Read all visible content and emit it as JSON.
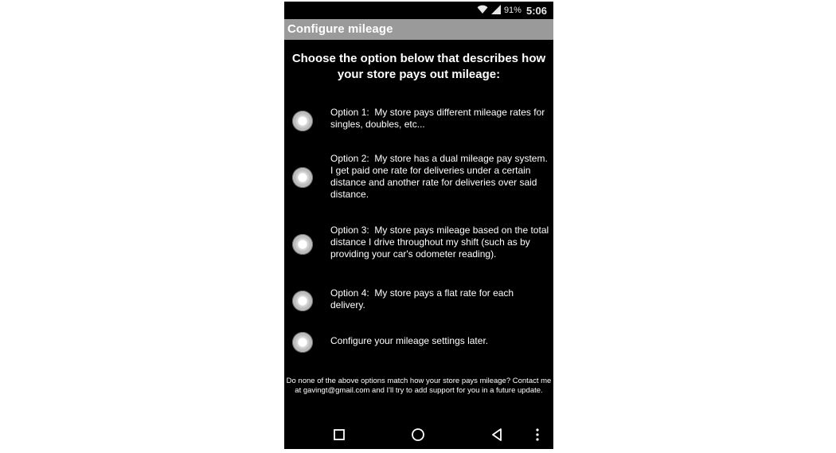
{
  "status_bar": {
    "battery": "91%",
    "time": "5:06",
    "icons": [
      "wifi-icon",
      "cellular-signal-icon"
    ]
  },
  "app_bar": {
    "title": "Configure mileage"
  },
  "heading": "Choose the option below that describes how your store pays out mileage:",
  "options": [
    {
      "label": "Option 1:  My store pays different mileage rates for singles, doubles, etc...",
      "selected": false
    },
    {
      "label": "Option 2:  My store has a dual mileage pay system. I get paid one rate for deliveries under a certain distance and another rate for deliveries over said distance.",
      "selected": false
    },
    {
      "label": "Option 3:  My store pays mileage based on the total distance I drive throughout my shift (such as by providing your car's odometer reading).",
      "selected": false
    },
    {
      "label": "Option 4:  My store pays a flat rate for each delivery.",
      "selected": false
    },
    {
      "label": "Configure your mileage settings later.",
      "selected": false
    }
  ],
  "footer_note": "Do none of the above options match how your store pays mileage? Contact me at gavingt@gmail.com and I'll try to add support for you in a future update.",
  "nav_bar": {
    "buttons": [
      "recents-square-icon",
      "home-circle-icon",
      "back-triangle-icon",
      "overflow-menu-icon"
    ]
  },
  "colors": {
    "background": "#000000",
    "app_bar": "#9a9a9a",
    "text": "#ffffff",
    "page": "#ffffff"
  }
}
